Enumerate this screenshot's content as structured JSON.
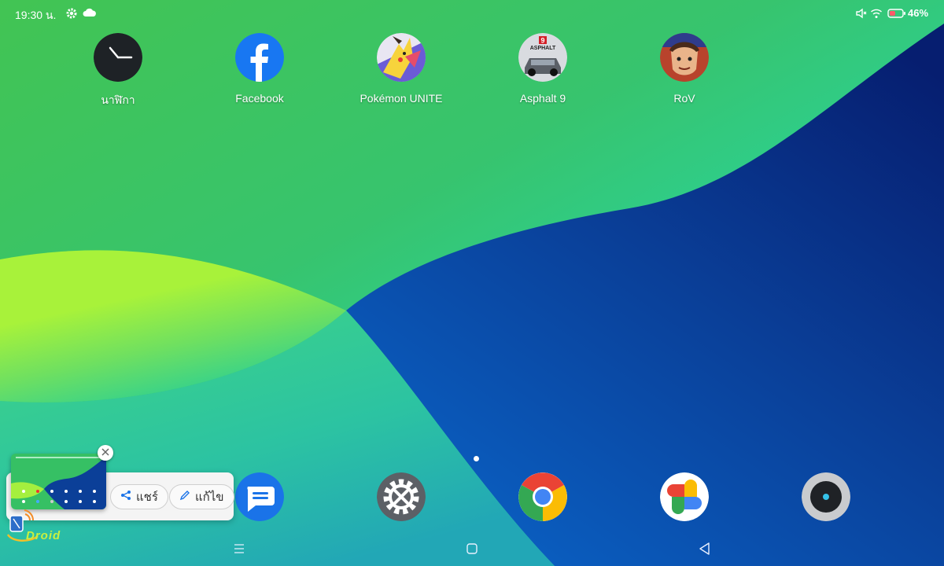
{
  "status_bar": {
    "time": "19:30 น.",
    "icons": [
      "settings-icon",
      "cloud-icon",
      "mute-icon",
      "wifi-icon",
      "battery-icon"
    ],
    "battery_percent": "46%",
    "battery_level": 0.46
  },
  "apps": [
    {
      "label": "นาฬิกา",
      "icon": "clock-icon"
    },
    {
      "label": "Facebook",
      "icon": "facebook-icon"
    },
    {
      "label": "Pokémon UNITE",
      "icon": "pokemon-unite-icon"
    },
    {
      "label": "Asphalt 9",
      "icon": "asphalt-9-icon"
    },
    {
      "label": "RoV",
      "icon": "rov-icon"
    }
  ],
  "asphalt_badge": "9",
  "asphalt_wordmark": "ASPHALT",
  "dock": [
    "messages-icon",
    "settings-gear-icon",
    "chrome-icon",
    "google-photos-icon",
    "camera-icon"
  ],
  "screenshot_preview": {
    "share_label": "แชร์",
    "edit_label": "แก้ไข"
  },
  "watermark_text": "Droid",
  "navigation": [
    "menu-icon",
    "home-icon",
    "back-icon"
  ],
  "colors": {
    "wallpaper_green": "#3ec55a",
    "wallpaper_blue": "#0a4aa8",
    "lime": "#a6f03a",
    "facebook_blue": "#1877f2",
    "messages_blue": "#1a73e8"
  }
}
